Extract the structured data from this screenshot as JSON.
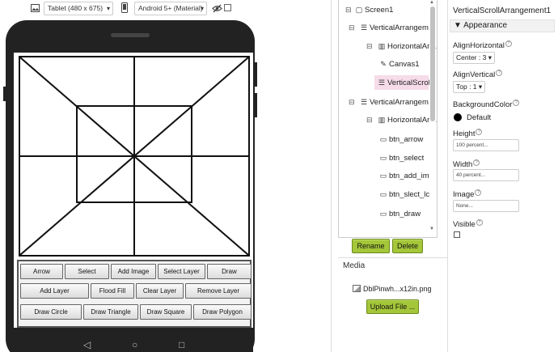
{
  "viewer": {
    "device_select": "Tablet (480 x 675)",
    "theme_select": "Android 5+ (Material)",
    "icons": {
      "screen_size": "image-icon",
      "phone_preview": "phone-icon",
      "hidden_components": "eye-off-icon"
    }
  },
  "phone_buttons": {
    "row1": [
      "Arrow",
      "Select",
      "Add Image",
      "Select Layer",
      "Draw"
    ],
    "row2": [
      "Add Layer",
      "Flood Fill",
      "Clear Layer",
      "Remove Layer"
    ],
    "row3": [
      "Draw Circle",
      "Draw Triangle",
      "Draw Square",
      "Draw Polygon"
    ]
  },
  "components_tree": [
    {
      "label": "Screen1",
      "icon": "screen-icon",
      "toggle": "collapse"
    },
    {
      "label": "VerticalArrangem",
      "icon": "vertical-arrangement-icon",
      "toggle": "collapse"
    },
    {
      "label": "HorizontalArran",
      "icon": "horizontal-arrangement-icon",
      "toggle": "collapse"
    },
    {
      "label": "Canvas1",
      "icon": "canvas-brush-icon",
      "toggle": ""
    },
    {
      "label": "VerticalScrol",
      "icon": "vertical-arrangement-icon",
      "toggle": "",
      "selected": true
    },
    {
      "label": "VerticalArrangem",
      "icon": "vertical-arrangement-icon",
      "toggle": "collapse"
    },
    {
      "label": "HorizontalArran",
      "icon": "horizontal-arrangement-icon",
      "toggle": "collapse"
    },
    {
      "label": "btn_arrow",
      "icon": "button-icon",
      "toggle": ""
    },
    {
      "label": "btn_select",
      "icon": "button-icon",
      "toggle": ""
    },
    {
      "label": "btn_add_im",
      "icon": "button-icon",
      "toggle": ""
    },
    {
      "label": "btn_slect_lc",
      "icon": "button-icon",
      "toggle": ""
    },
    {
      "label": "btn_draw",
      "icon": "button-icon",
      "toggle": ""
    }
  ],
  "tree_actions": {
    "rename": "Rename",
    "delete": "Delete"
  },
  "media": {
    "title": "Media",
    "file": "DblPinwh...x12in.png",
    "upload": "Upload File ..."
  },
  "properties": {
    "component": "VerticalScrollArrangement1",
    "section": "Appearance",
    "align_horizontal_label": "AlignHorizontal",
    "align_horizontal_value": "Center : 3",
    "align_vertical_label": "AlignVertical",
    "align_vertical_value": "Top : 1",
    "bg_color_label": "BackgroundColor",
    "bg_color_value": "Default",
    "bg_color_hex": "#000000",
    "height_label": "Height",
    "height_value": "100 percent...",
    "width_label": "Width",
    "width_value": "40 percent...",
    "image_label": "Image",
    "image_value": "None...",
    "visible_label": "Visible",
    "visible_checked": false
  },
  "colors": {
    "accent_green": "#a4c639",
    "selected_row": "#f6dbe8",
    "phone_body": "#222222"
  }
}
